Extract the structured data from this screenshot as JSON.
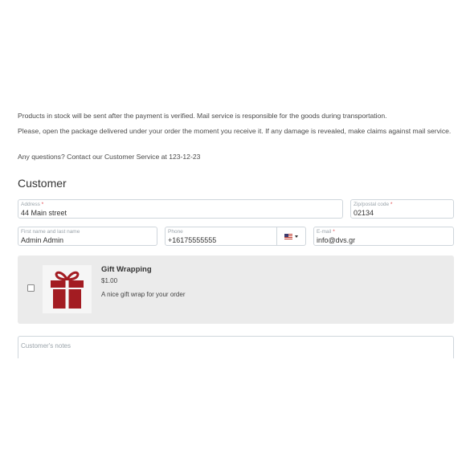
{
  "info": {
    "line1": "Products in stock will be sent after the payment is verified. Mail service is responsible for the goods during transportation.",
    "line2": "Please, open the package delivered under your order the moment you receive it. If any damage is revealed, make claims against mail service.",
    "line3": "Any questions? Contact our Customer Service at 123-12-23"
  },
  "customer": {
    "heading": "Customer",
    "address": {
      "label": "Address",
      "required": "*",
      "value": "44 Main street"
    },
    "zip": {
      "label": "Zip/postal code",
      "required": "*",
      "value": "02134"
    },
    "name": {
      "label": "First name and last name",
      "value": "Admin Admin"
    },
    "phone": {
      "label": "Phone",
      "value": "+16175555555",
      "country": "us-flag-icon"
    },
    "email": {
      "label": "E-mail",
      "required": "*",
      "value": "info@dvs.gr"
    }
  },
  "gift": {
    "title": "Gift Wrapping",
    "price": "$1.00",
    "description": "A nice gift wrap for your order",
    "checked": false,
    "icon": "gift-icon",
    "color": "#a31c22"
  },
  "notes": {
    "placeholder": "Customer's notes"
  }
}
